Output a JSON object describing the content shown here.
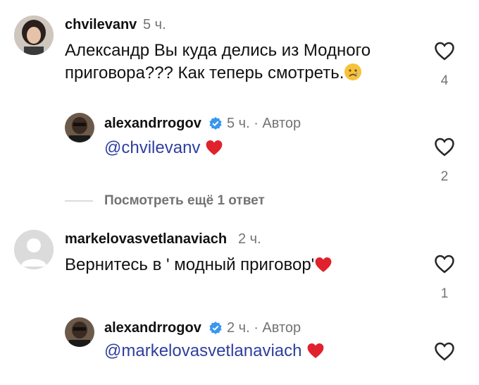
{
  "comments": [
    {
      "username": "chvilevanv",
      "time": "5 ч.",
      "line1": "Александр Вы куда делись из Модного",
      "line2": "приговора??? Как теперь смотреть.",
      "likes": "4",
      "emoji": "crying-face"
    },
    {
      "username": "alexandrrogov",
      "time": "5 ч. · Автор",
      "mention": "@chvilevanv",
      "likes": "2",
      "emoji": "red-heart"
    },
    {
      "username": "markelovasvetlanaviach",
      "time": "2 ч.",
      "text": "Вернитесь в ' модный приговор'",
      "likes": "1",
      "emoji": "red-heart"
    },
    {
      "username": "alexandrrogov",
      "time": "2 ч. · Автор",
      "mention": "@markelovasvetlanaviach",
      "emoji": "red-heart"
    }
  ],
  "view_more": "Посмотреть ещё 1 ответ",
  "colors": {
    "mention": "#2e3f9e",
    "meta": "#737373",
    "verified": "#3897f0",
    "heart": "#e0222d"
  }
}
